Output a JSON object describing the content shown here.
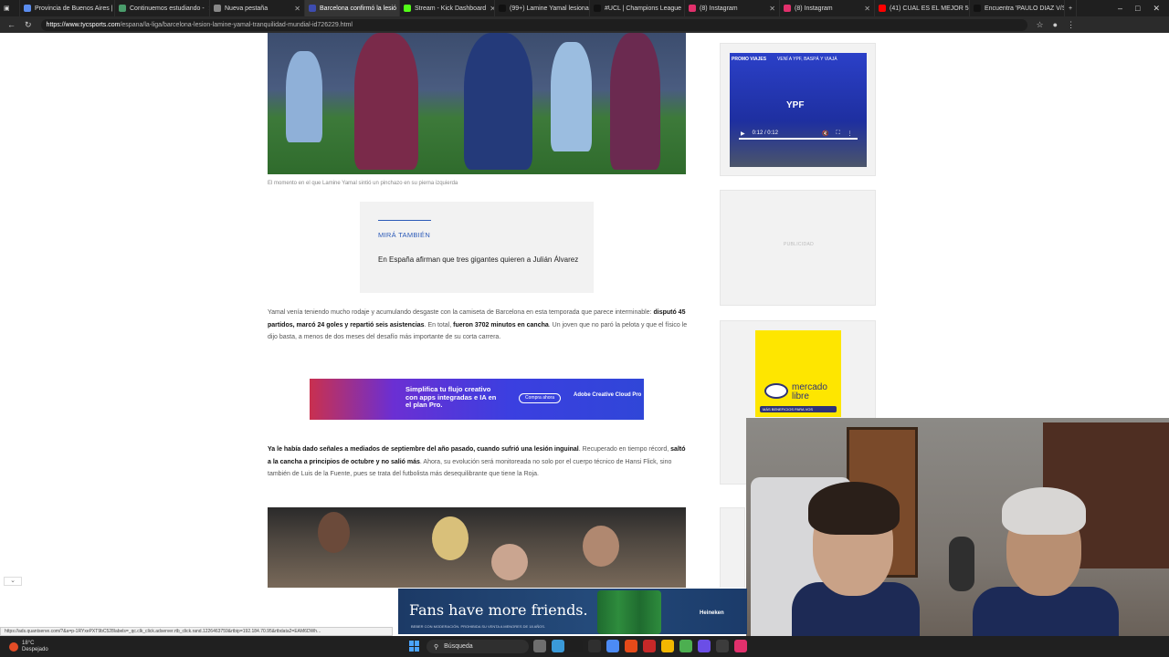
{
  "tabs": [
    {
      "label": "Provincia de Buenos Aires |",
      "color": "#5b8def"
    },
    {
      "label": "Continuemos estudiando -",
      "color": "#4a9c6b"
    },
    {
      "label": "Nueva pestaña",
      "color": "#888888"
    },
    {
      "label": "Barcelona confirmó la lesió",
      "color": "#3d4cb0",
      "active": true
    },
    {
      "label": "Stream - Kick Dashboard",
      "color": "#53fc18"
    },
    {
      "label": "(99+) Lamine Yamal lesiona",
      "color": "#111111"
    },
    {
      "label": "#UCL | Champions League",
      "color": "#111111"
    },
    {
      "label": "(8) Instagram",
      "color": "#e1306c"
    },
    {
      "label": "(8) Instagram",
      "color": "#e1306c"
    },
    {
      "label": "(41) CUAL ES EL MEJOR 5 D",
      "color": "#ff0000"
    },
    {
      "label": "Encuentra 'PAULO DIAZ V/S",
      "color": "#111111"
    }
  ],
  "address": {
    "url_domain": "https://www.tycsports.com",
    "url_path": "/espana/la-liga/barcelona-lesion-lamine-yamal-tranquilidad-mundial-id726229.html"
  },
  "article": {
    "caption": "El momento en el que Lamine Yamal sintió un pinchazo en su pierna izquierda",
    "also_label": "MIRÁ TAMBIÉN",
    "also_title": "En España afirman que tres gigantes quieren a Julián Álvarez",
    "p1_a": "Yamal venía teniendo mucho rodaje y acumulando desgaste con la camiseta de Barcelona en esta temporada que parece interminable: ",
    "p1_b": "disputó 45 partidos, marcó 24 goles y repartió seis asistencias",
    "p1_c": ". En total, ",
    "p1_d": "fueron 3702 minutos en cancha",
    "p1_e": ". Un joven que no paró la pelota y que el físico le dijo basta, a menos de dos meses del desafío más importante de su corta carrera.",
    "p2_a": "Ya le había dado señales a mediados de septiembre del año pasado, cuando sufrió una lesión inguinal",
    "p2_b": ". Recuperado en tiempo récord, ",
    "p2_c": "saltó a la cancha a principios de octubre y no salió más",
    "p2_d": ". Ahora, su evolución será monitoreada no solo por el cuerpo técnico de Hansi Flick, sino también de Luis de la Fuente, pues se trata del futbolista más desequilibrante que tiene la Roja."
  },
  "ads": {
    "adobe_text": "Simplifica tu flujo creativo con apps integradas e IA en el plan Pro.",
    "adobe_button": "Compra ahora",
    "adobe_brand": "Adobe Creative Cloud Pro",
    "ypf_promo": "PROMO VIAJES",
    "ypf_promo2": "VENÍ A YPF, BASPÁ Y VIAJÁ",
    "ypf_logo": "YPF",
    "video_time": "0:12 / 0:12",
    "publicidad": "PUBLICIDAD",
    "ml_brand": "mercado libre",
    "ml_strip": "MÁS BENEFICIOS PARA VOS",
    "heineken_text": "Fans have more friends.",
    "heineken_small": "BEBER CON MODERACIÓN. PROHIBIDA SU VENTA A MENORES DE 18 AÑOS.",
    "heineken_brand": "Heineken"
  },
  "status_url": "https://ads.quantserve.com/?&a=p-1RYxePXT9bC528labels=_qc.clk_click.adserver.rtb_click.rand.1226463759&rtbip=192.184.70.95&rtbdata2=EAM6DWh...",
  "taskbar": {
    "temp": "18°C",
    "weather": "Despejado",
    "search_placeholder": "Búsqueda",
    "icon_colors": [
      "#6e6e6e",
      "#3a9ad9",
      "#1f1f1f",
      "#2f2f2f",
      "#4c8bf5",
      "#e64a19",
      "#c62828",
      "#f2b701",
      "#4caf50",
      "#6b4ee6",
      "#3c3c3c",
      "#e1306c"
    ]
  }
}
